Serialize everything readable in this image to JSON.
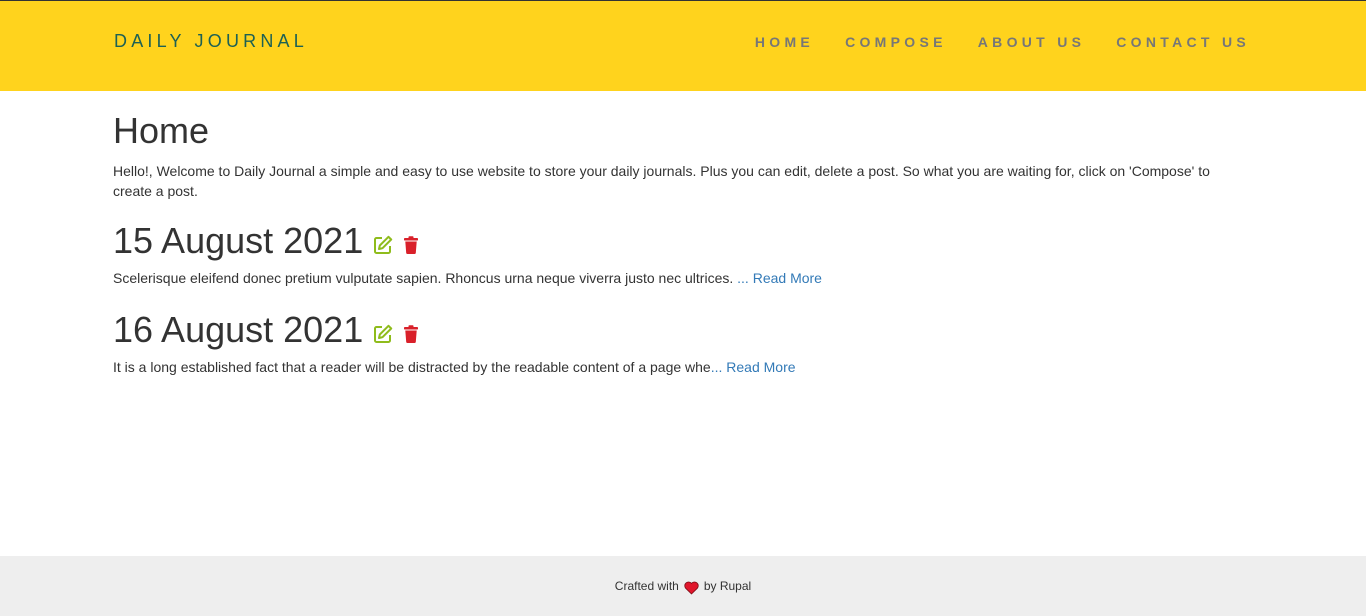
{
  "header": {
    "brand": "DAILY JOURNAL",
    "nav": [
      "HOME",
      "COMPOSE",
      "ABOUT US",
      "CONTACT US"
    ],
    "background": "#ffd31d",
    "brand_color": "#1d6154"
  },
  "main": {
    "title": "Home",
    "intro": "Hello!, Welcome to Daily Journal a simple and easy to use website to store your daily journals. Plus you can edit, delete a post. So what you are waiting for, click on 'Compose' to create a post.",
    "posts": [
      {
        "date": "15 August 2021",
        "excerpt": "Scelerisque eleifend donec pretium vulputate sapien. Rhoncus urna neque viverra justo nec ultrices. ",
        "link": "... Read More"
      },
      {
        "date": "16 August 2021",
        "excerpt": "It is a long established fact that a reader will be distracted by the readable content of a page whe",
        "link": "... Read More"
      }
    ],
    "edit_icon": "edit-icon",
    "delete_icon": "trash-icon",
    "edit_color": "#8fbc1c",
    "delete_color": "#d9202a"
  },
  "footer": {
    "prefix": "Crafted with",
    "suffix": "by Rupal",
    "icon": "heart-icon"
  }
}
